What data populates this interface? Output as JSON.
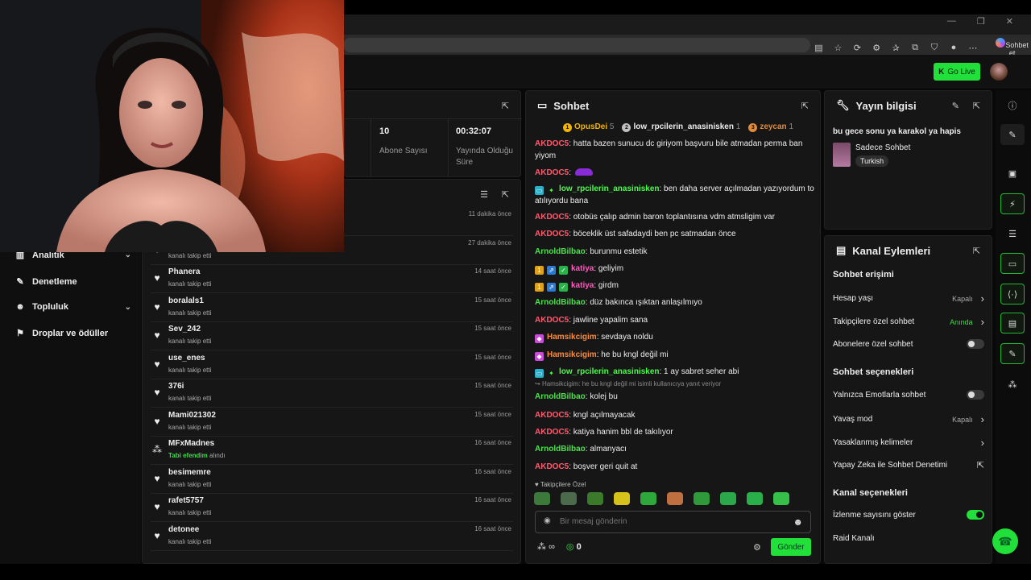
{
  "browser": {
    "copilot_label": "Sohbet et",
    "win_min": "—",
    "win_max": "❐",
    "win_close": "✕"
  },
  "header": {
    "go_live": "Go Live"
  },
  "leftnav": [
    {
      "label": "Analitik",
      "has_chevron": true,
      "icon": "chart-icon"
    },
    {
      "label": "Denetleme",
      "has_chevron": false,
      "icon": "wrench-icon"
    },
    {
      "label": "Topluluk",
      "has_chevron": true,
      "icon": "community-icon"
    },
    {
      "label": "Droplar ve ödüller",
      "has_chevron": false,
      "icon": "gift-icon"
    }
  ],
  "stats": [
    {
      "value": "10",
      "label": "Abone Sayısı"
    },
    {
      "value": "00:32:07",
      "label": "Yayında Olduğu Süre"
    }
  ],
  "activity": [
    {
      "name": "",
      "sub": "",
      "time": "11 dakika önce",
      "icon": "heart-icon"
    },
    {
      "name": "",
      "sub": "kanalı takip etti",
      "time": "27 dakika önce",
      "icon": "heart-icon"
    },
    {
      "name": "Phanera",
      "sub": "kanalı takip etti",
      "time": "14 saat önce",
      "icon": "heart-icon"
    },
    {
      "name": "boralals1",
      "sub": "kanalı takip etti",
      "time": "15 saat önce",
      "icon": "heart-icon"
    },
    {
      "name": "Sev_242",
      "sub": "kanalı takip etti",
      "time": "15 saat önce",
      "icon": "heart-icon"
    },
    {
      "name": "use_enes",
      "sub": "kanalı takip etti",
      "time": "15 saat önce",
      "icon": "heart-icon"
    },
    {
      "name": "376i",
      "sub": "kanalı takip etti",
      "time": "15 saat önce",
      "icon": "heart-icon"
    },
    {
      "name": "Mami021302",
      "sub": "kanalı takip etti",
      "time": "15 saat önce",
      "icon": "heart-icon"
    },
    {
      "name": "MFxMadnes",
      "sub_reward": "Tabi efendim",
      "sub": "alındı",
      "time": "16 saat önce",
      "icon": "points-icon"
    },
    {
      "name": "besimemre",
      "sub": "kanalı takip etti",
      "time": "16 saat önce",
      "icon": "heart-icon"
    },
    {
      "name": "rafet5757",
      "sub": "kanalı takip etti",
      "time": "16 saat önce",
      "icon": "heart-icon"
    },
    {
      "name": "detonee",
      "sub": "kanalı takip etti",
      "time": "16 saat önce",
      "icon": "heart-icon"
    }
  ],
  "chat": {
    "title": "Sohbet",
    "top_users": [
      {
        "rank": "1",
        "name": "OpusDei",
        "count": "5",
        "color": "#f4b400"
      },
      {
        "rank": "2",
        "name": "low_rpcilerin_anasinisken",
        "count": "1",
        "color": "#c0c0c0"
      },
      {
        "rank": "3",
        "name": "zeycan",
        "count": "1",
        "color": "#e08a3a"
      }
    ],
    "messages": [
      {
        "user": "AKDOC5",
        "cls": "u-ak",
        "text": ": hatta bazen sunucu dc giriyom başvuru bile atmadan perma ban yiyom"
      },
      {
        "user": "AKDOC5",
        "cls": "u-ak",
        "text": ": ",
        "emote": true
      },
      {
        "user": "low_rpcilerin_anasinisken",
        "cls": "u-lo",
        "text": ": ben daha server açılmadan yazıyordum to atılıyordu bana",
        "badges": 2
      },
      {
        "user": "AKDOC5",
        "cls": "u-ak",
        "text": ": otobüs çalıp admin baron toplantısına vdm atmsligim var"
      },
      {
        "user": "AKDOC5",
        "cls": "u-ak",
        "text": ": böceklik üst safadaydi ben pc satmadan önce"
      },
      {
        "user": "ArnoldBilbao",
        "cls": "u-ar",
        "text": ": burunmu estetik"
      },
      {
        "user": "katiya",
        "cls": "u-ka",
        "text": ": geliyim",
        "badges": 3
      },
      {
        "user": "katiya",
        "cls": "u-ka",
        "text": ": girdm",
        "badges": 3
      },
      {
        "user": "ArnoldBilbao",
        "cls": "u-ar",
        "text": ": düz bakınca ışıktan anlaşılmıyo"
      },
      {
        "user": "AKDOC5",
        "cls": "u-ak",
        "text": ": jawline yapalim sana"
      },
      {
        "user": "Hamsikcigim",
        "cls": "u-ha",
        "text": ": sevdaya noldu",
        "badges": 1
      },
      {
        "user": "Hamsikcigim",
        "cls": "u-ha",
        "text": ": he bu kngl değil mi",
        "badges": 1
      },
      {
        "user": "low_rpcilerin_anasinisken",
        "cls": "u-lo",
        "text": ": 1 ay sabret seher abi",
        "badges": 2
      },
      {
        "user": "ArnoldBilbao",
        "cls": "u-ar",
        "text": ": kolej bu",
        "reply": "Hamsikcigim: he bu kngl değil mi isimli kullanıcıya yanıt veriyor"
      },
      {
        "user": "AKDOC5",
        "cls": "u-ak",
        "text": ": kngl açılmayacak"
      },
      {
        "user": "AKDOC5",
        "cls": "u-ak",
        "text": ": katiya hanim bbl de takılıyor"
      },
      {
        "user": "ArnoldBilbao",
        "cls": "u-ar",
        "text": ": almanyacı"
      },
      {
        "user": "AKDOC5",
        "cls": "u-ak",
        "text": ": boşver geri quit at"
      }
    ],
    "followers_only": "Takipçilere Özel",
    "input_placeholder": "Bir mesaj gönderin",
    "points": "0",
    "infinity": "∞",
    "send": "Gönder"
  },
  "stream_info": {
    "title_label": "Yayın bilgisi",
    "stream_title": "bu gece sonu ya karakol ya hapis",
    "category": "Sadece Sohbet",
    "tag": "Turkish"
  },
  "channel_actions": {
    "title": "Kanal Eylemleri",
    "sections": [
      {
        "head": "Sohbet erişimi"
      },
      {
        "label": "Hesap yaşı",
        "value": "Kapalı",
        "type": "nav"
      },
      {
        "label": "Takipçilere özel sohbet",
        "value": "Anında",
        "type": "nav-green"
      },
      {
        "label": "Abonelere özel sohbet",
        "type": "toggle",
        "on": false
      },
      {
        "head": "Sohbet seçenekleri"
      },
      {
        "label": "Yalnızca Emotlarla sohbet",
        "type": "toggle",
        "on": false
      },
      {
        "label": "Yavaş mod",
        "value": "Kapalı",
        "type": "nav"
      },
      {
        "label": "Yasaklanmış kelimeler",
        "value": "",
        "type": "nav"
      },
      {
        "label": "Yapay Zeka ile Sohbet Denetimi",
        "type": "external"
      },
      {
        "head": "Kanal seçenekleri"
      },
      {
        "label": "İzlenme sayısını göster",
        "type": "toggle",
        "on": true
      },
      {
        "label": "Raid Kanalı",
        "type": "none"
      }
    ]
  },
  "colors": {
    "accent": "#22e03a"
  }
}
